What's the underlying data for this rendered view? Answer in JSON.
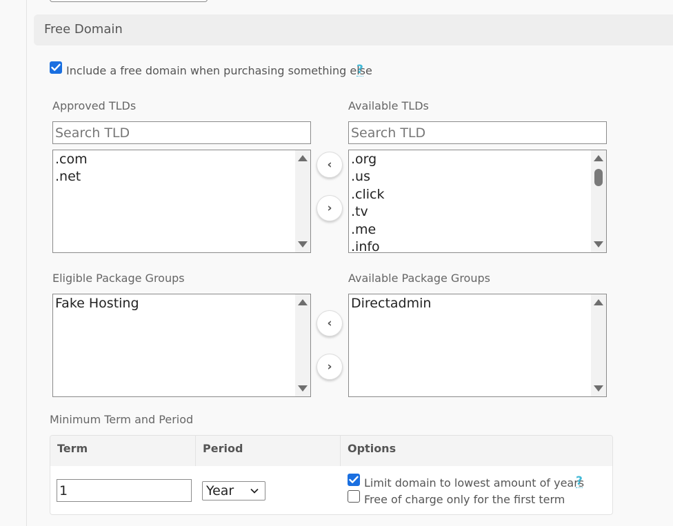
{
  "section": {
    "title": "Free Domain"
  },
  "include_free_domain": {
    "label": "Include a free domain when purchasing something else",
    "checked": true,
    "help": "?"
  },
  "tlds": {
    "approved_label": "Approved TLDs",
    "available_label": "Available TLDs",
    "search_placeholder": "Search TLD",
    "approved": [
      ".com",
      ".net"
    ],
    "available": [
      ".org",
      ".us",
      ".click",
      ".tv",
      ".me",
      ".info"
    ]
  },
  "packages": {
    "eligible_label": "Eligible Package Groups",
    "available_label": "Available Package Groups",
    "eligible": [
      "Fake Hosting"
    ],
    "available": [
      "Directadmin"
    ]
  },
  "move_buttons": {
    "left": "‹",
    "right": "›"
  },
  "term_period": {
    "label": "Minimum Term and Period",
    "headers": {
      "term": "Term",
      "period": "Period",
      "options": "Options"
    },
    "term_value": "1",
    "period_value": "Year",
    "options": [
      {
        "label": "Limit domain to lowest amount of years",
        "checked": true,
        "help": "?"
      },
      {
        "label": "Free of charge only for the first term",
        "checked": false
      }
    ]
  },
  "colors": {
    "accent": "#1a6fe0",
    "help": "#43b9d6"
  }
}
